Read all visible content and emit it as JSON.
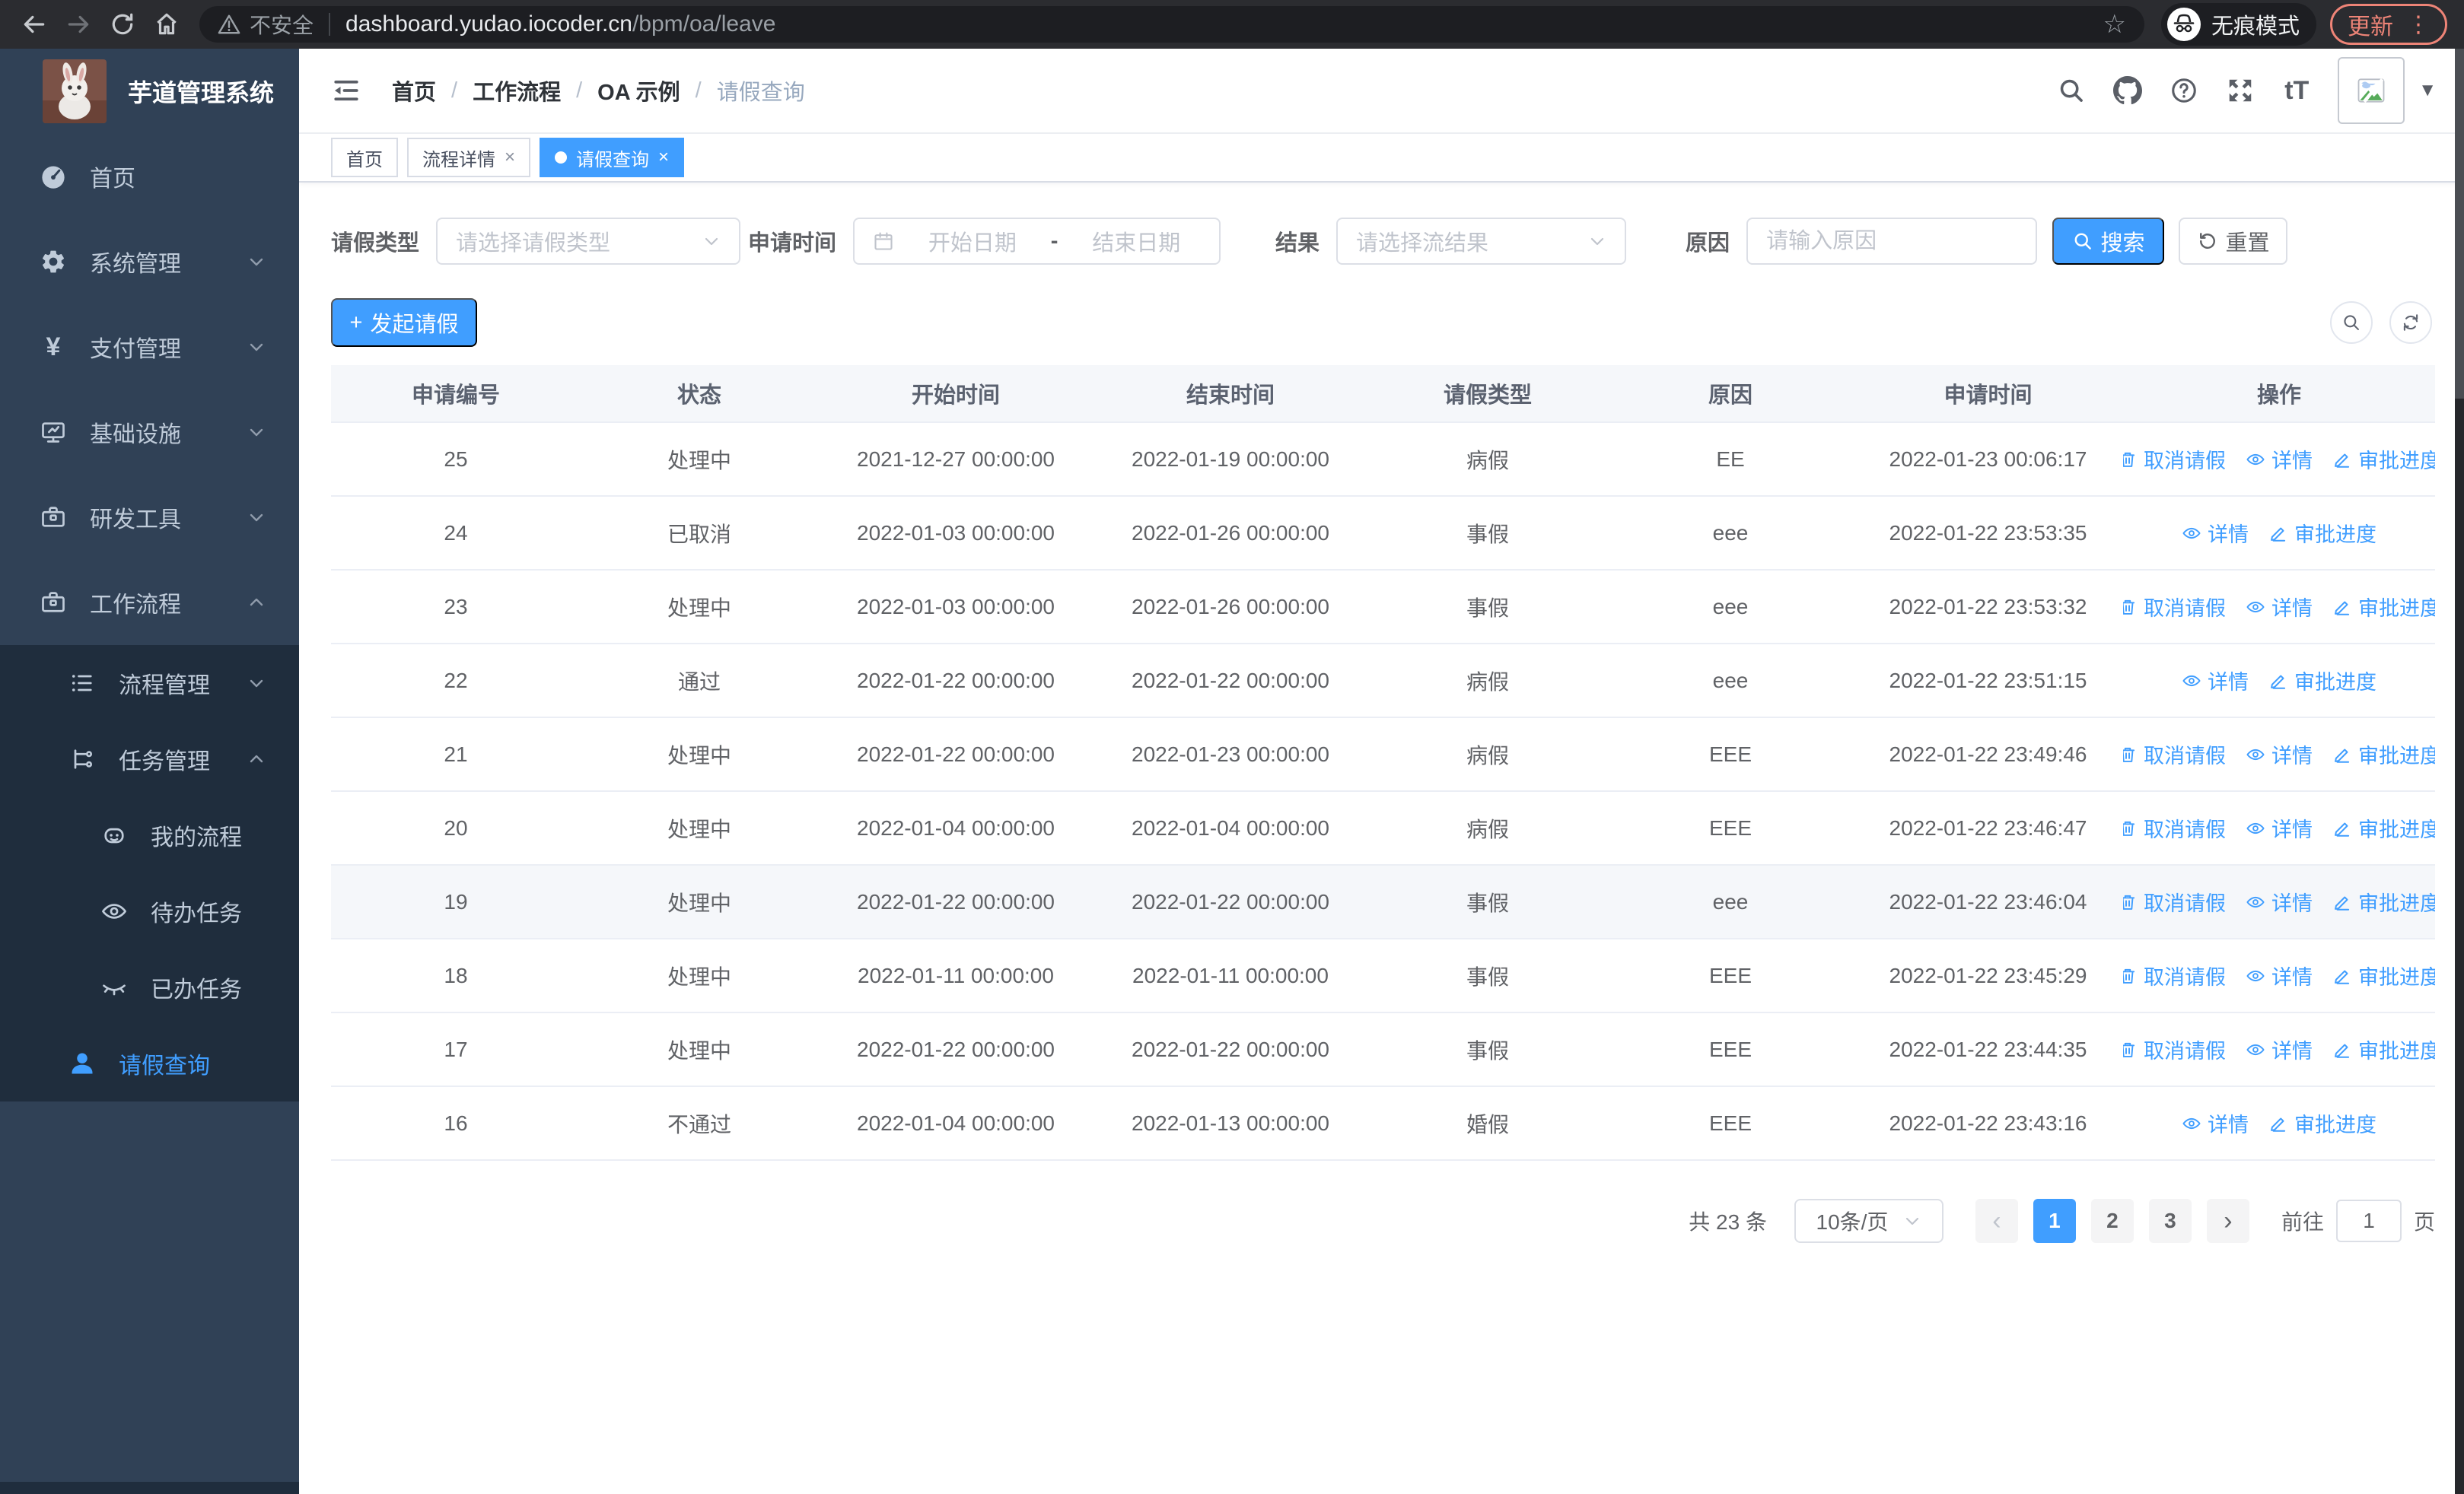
{
  "colors": {
    "accent_blue": "#409eff",
    "sidebar_bg": "#304156",
    "submenu_bg": "#1f2d3d",
    "update_red": "#ee8477",
    "table_border": "#ebeef5",
    "header_bg": "#f5f7fa"
  },
  "icons": {
    "yen": "¥",
    "font_size": "tT",
    "dots_vertical": "⋮",
    "caret_down": "▼",
    "star": "☆",
    "plus": "+",
    "close": "×",
    "prev": "‹",
    "next": "›"
  },
  "browser": {
    "security_label": "不安全",
    "url_host": "dashboard.yudao.iocoder.cn",
    "url_path": "/bpm/oa/leave",
    "incognito_label": "无痕模式",
    "update_label": "更新"
  },
  "sidebar": {
    "app_title": "芋道管理系统",
    "items": [
      {
        "label": "首页"
      },
      {
        "label": "系统管理"
      },
      {
        "label": "支付管理"
      },
      {
        "label": "基础设施"
      },
      {
        "label": "研发工具"
      },
      {
        "label": "工作流程"
      },
      {
        "label": "流程管理"
      },
      {
        "label": "任务管理"
      },
      {
        "label": "我的流程"
      },
      {
        "label": "待办任务"
      },
      {
        "label": "已办任务"
      },
      {
        "label": "请假查询"
      }
    ]
  },
  "header": {
    "breadcrumb": [
      "首页",
      "工作流程",
      "OA 示例",
      "请假查询"
    ],
    "breadcrumb_separator": "/"
  },
  "tabs": [
    {
      "label": "首页",
      "active": false,
      "closable": false
    },
    {
      "label": "流程详情",
      "active": false,
      "closable": true
    },
    {
      "label": "请假查询",
      "active": true,
      "closable": true
    }
  ],
  "filters": {
    "leave_type": {
      "label": "请假类型",
      "placeholder": "请选择请假类型"
    },
    "apply_time": {
      "label": "申请时间",
      "start_placeholder": "开始日期",
      "separator": "-",
      "end_placeholder": "结束日期"
    },
    "result": {
      "label": "结果",
      "placeholder": "请选择流结果"
    },
    "reason": {
      "label": "原因",
      "placeholder": "请输入原因"
    },
    "search_label": "搜索",
    "reset_label": "重置"
  },
  "toolbar": {
    "create_label": "发起请假"
  },
  "table": {
    "columns": [
      "申请编号",
      "状态",
      "开始时间",
      "结束时间",
      "请假类型",
      "原因",
      "申请时间",
      "操作"
    ],
    "action_labels": {
      "cancel": "取消请假",
      "detail": "详情",
      "progress": "审批进度"
    },
    "rows": [
      {
        "id": "25",
        "status": "处理中",
        "start": "2021-12-27 00:00:00",
        "end": "2022-01-19 00:00:00",
        "type": "病假",
        "reason": "EE",
        "apply_time": "2022-01-23 00:06:17",
        "actions": [
          "cancel",
          "detail",
          "progress"
        ],
        "highlight": false
      },
      {
        "id": "24",
        "status": "已取消",
        "start": "2022-01-03 00:00:00",
        "end": "2022-01-26 00:00:00",
        "type": "事假",
        "reason": "eee",
        "apply_time": "2022-01-22 23:53:35",
        "actions": [
          "detail",
          "progress"
        ],
        "highlight": false
      },
      {
        "id": "23",
        "status": "处理中",
        "start": "2022-01-03 00:00:00",
        "end": "2022-01-26 00:00:00",
        "type": "事假",
        "reason": "eee",
        "apply_time": "2022-01-22 23:53:32",
        "actions": [
          "cancel",
          "detail",
          "progress"
        ],
        "highlight": false
      },
      {
        "id": "22",
        "status": "通过",
        "start": "2022-01-22 00:00:00",
        "end": "2022-01-22 00:00:00",
        "type": "病假",
        "reason": "eee",
        "apply_time": "2022-01-22 23:51:15",
        "actions": [
          "detail",
          "progress"
        ],
        "highlight": false
      },
      {
        "id": "21",
        "status": "处理中",
        "start": "2022-01-22 00:00:00",
        "end": "2022-01-23 00:00:00",
        "type": "病假",
        "reason": "EEE",
        "apply_time": "2022-01-22 23:49:46",
        "actions": [
          "cancel",
          "detail",
          "progress"
        ],
        "highlight": false
      },
      {
        "id": "20",
        "status": "处理中",
        "start": "2022-01-04 00:00:00",
        "end": "2022-01-04 00:00:00",
        "type": "病假",
        "reason": "EEE",
        "apply_time": "2022-01-22 23:46:47",
        "actions": [
          "cancel",
          "detail",
          "progress"
        ],
        "highlight": false
      },
      {
        "id": "19",
        "status": "处理中",
        "start": "2022-01-22 00:00:00",
        "end": "2022-01-22 00:00:00",
        "type": "事假",
        "reason": "eee",
        "apply_time": "2022-01-22 23:46:04",
        "actions": [
          "cancel",
          "detail",
          "progress"
        ],
        "highlight": true
      },
      {
        "id": "18",
        "status": "处理中",
        "start": "2022-01-11 00:00:00",
        "end": "2022-01-11 00:00:00",
        "type": "事假",
        "reason": "EEE",
        "apply_time": "2022-01-22 23:45:29",
        "actions": [
          "cancel",
          "detail",
          "progress"
        ],
        "highlight": false
      },
      {
        "id": "17",
        "status": "处理中",
        "start": "2022-01-22 00:00:00",
        "end": "2022-01-22 00:00:00",
        "type": "事假",
        "reason": "EEE",
        "apply_time": "2022-01-22 23:44:35",
        "actions": [
          "cancel",
          "detail",
          "progress"
        ],
        "highlight": false
      },
      {
        "id": "16",
        "status": "不通过",
        "start": "2022-01-04 00:00:00",
        "end": "2022-01-13 00:00:00",
        "type": "婚假",
        "reason": "EEE",
        "apply_time": "2022-01-22 23:43:16",
        "actions": [
          "detail",
          "progress"
        ],
        "highlight": false
      }
    ]
  },
  "pagination": {
    "total_label": "共 23 条",
    "page_size": "10条/页",
    "pages": [
      "1",
      "2",
      "3"
    ],
    "active_page": "1",
    "goto_label": "前往",
    "goto_value": "1",
    "page_unit": "页"
  }
}
